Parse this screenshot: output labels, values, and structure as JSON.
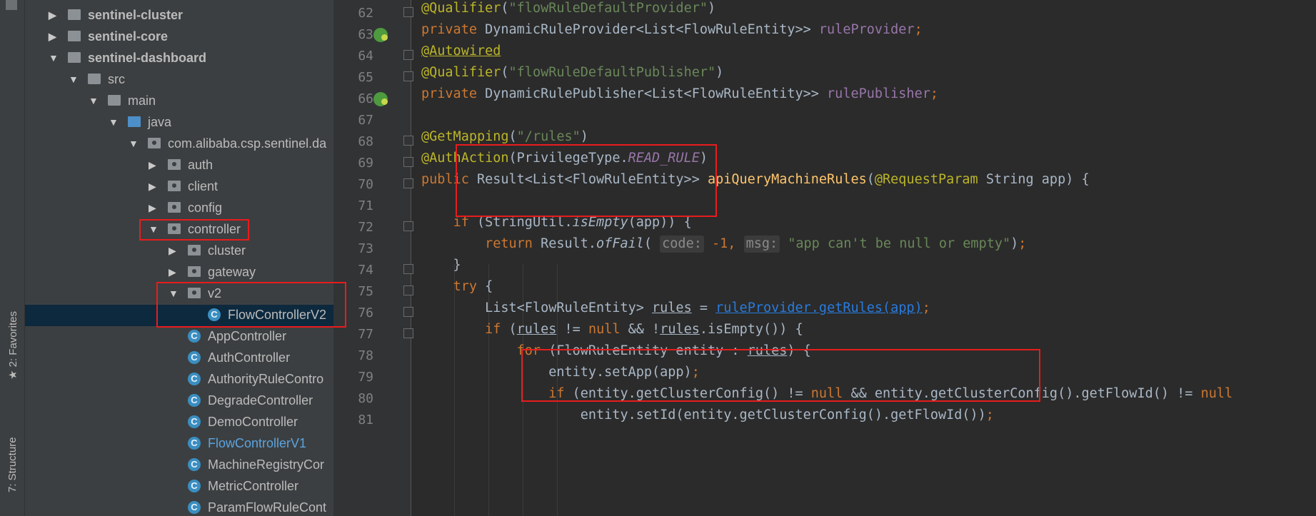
{
  "side_tabs": {
    "favorites": "2: Favorites",
    "structure": "7: Structure"
  },
  "tree": [
    {
      "label": "sentinel-cluster",
      "level": 0,
      "icon": "module",
      "arrow": "▶",
      "bold": true
    },
    {
      "label": "sentinel-core",
      "level": 0,
      "icon": "module",
      "arrow": "▶",
      "bold": true
    },
    {
      "label": "sentinel-dashboard",
      "level": 0,
      "icon": "module",
      "arrow": "▼",
      "bold": true
    },
    {
      "label": "src",
      "level": 1,
      "icon": "folder",
      "arrow": "▼"
    },
    {
      "label": "main",
      "level": 2,
      "icon": "folder",
      "arrow": "▼"
    },
    {
      "label": "java",
      "level": 3,
      "icon": "src",
      "arrow": "▼"
    },
    {
      "label": "com.alibaba.csp.sentinel.da",
      "level": 4,
      "icon": "pkg",
      "arrow": "▼"
    },
    {
      "label": "auth",
      "level": 5,
      "icon": "pkg",
      "arrow": "▶"
    },
    {
      "label": "client",
      "level": 5,
      "icon": "pkg",
      "arrow": "▶"
    },
    {
      "label": "config",
      "level": 5,
      "icon": "pkg",
      "arrow": "▶"
    },
    {
      "label": "controller",
      "level": 5,
      "icon": "pkg",
      "arrow": "▼"
    },
    {
      "label": "cluster",
      "level": 6,
      "icon": "pkg",
      "arrow": "▶"
    },
    {
      "label": "gateway",
      "level": 6,
      "icon": "pkg",
      "arrow": "▶"
    },
    {
      "label": "v2",
      "level": 6,
      "icon": "pkg",
      "arrow": "▼"
    },
    {
      "label": "FlowControllerV2",
      "level": 7,
      "icon": "cls",
      "arrow": "",
      "selected": true
    },
    {
      "label": "AppController",
      "level": 6,
      "icon": "cls",
      "arrow": ""
    },
    {
      "label": "AuthController",
      "level": 6,
      "icon": "cls",
      "arrow": ""
    },
    {
      "label": "AuthorityRuleContro",
      "level": 6,
      "icon": "cls",
      "arrow": ""
    },
    {
      "label": "DegradeController",
      "level": 6,
      "icon": "cls",
      "arrow": ""
    },
    {
      "label": "DemoController",
      "level": 6,
      "icon": "cls",
      "arrow": ""
    },
    {
      "label": "FlowControllerV1",
      "level": 6,
      "icon": "cls",
      "arrow": "",
      "color": "#5ba4e0"
    },
    {
      "label": "MachineRegistryCor",
      "level": 6,
      "icon": "cls",
      "arrow": ""
    },
    {
      "label": "MetricController",
      "level": 6,
      "icon": "cls",
      "arrow": ""
    },
    {
      "label": "ParamFlowRuleCont",
      "level": 6,
      "icon": "cls",
      "arrow": ""
    }
  ],
  "line_numbers": [
    "62",
    "63",
    "64",
    "65",
    "66",
    "67",
    "68",
    "69",
    "70",
    "71",
    "72",
    "73",
    "74",
    "75",
    "76",
    "77",
    "78",
    "79",
    "80",
    "81"
  ],
  "code_lines": [
    [
      [
        "an",
        "@Qualifier"
      ],
      [
        "",
        "("
      ],
      [
        "st",
        "\"flowRuleDefaultProvider\""
      ],
      [
        "",
        ")"
      ]
    ],
    [
      [
        "kw",
        "private "
      ],
      [
        "",
        "DynamicRuleProvider<List<FlowRuleEntity>> "
      ],
      [
        "fd",
        "ruleProvider"
      ],
      [
        "kw",
        ";"
      ]
    ],
    [
      [
        "an und",
        "@Autowired"
      ]
    ],
    [
      [
        "an",
        "@Qualifier"
      ],
      [
        "",
        "("
      ],
      [
        "st",
        "\"flowRuleDefaultPublisher\""
      ],
      [
        "",
        ")"
      ]
    ],
    [
      [
        "kw",
        "private "
      ],
      [
        "",
        "DynamicRulePublisher<List<FlowRuleEntity>> "
      ],
      [
        "fd",
        "rulePublisher"
      ],
      [
        "kw",
        ";"
      ]
    ],
    [],
    [
      [
        "an",
        "@GetMapping"
      ],
      [
        "",
        "("
      ],
      [
        "st",
        "\"/rules\""
      ],
      [
        "",
        ")"
      ]
    ],
    [
      [
        "an",
        "@AuthAction"
      ],
      [
        "",
        "(PrivilegeType."
      ],
      [
        "fd it",
        "READ_RULE"
      ],
      [
        "",
        ")"
      ]
    ],
    [
      [
        "kw",
        "public "
      ],
      [
        "",
        "Result<List<FlowRuleEntity>> "
      ],
      [
        "fn",
        "apiQueryMachineRules"
      ],
      [
        "",
        "("
      ],
      [
        "an",
        "@RequestParam "
      ],
      [
        "",
        "String app) {"
      ]
    ],
    [],
    [
      [
        "",
        "    "
      ],
      [
        "kw",
        "if "
      ],
      [
        "",
        "(StringUtil."
      ],
      [
        "it",
        "isEmpty"
      ],
      [
        "",
        "(app)) {"
      ]
    ],
    [
      [
        "",
        "        "
      ],
      [
        "kw",
        "return "
      ],
      [
        "",
        "Result."
      ],
      [
        "it",
        "ofFail"
      ],
      [
        "",
        "( "
      ],
      [
        "hint",
        "code:"
      ],
      [
        "",
        ""
      ],
      [
        "kw",
        " -1"
      ],
      [
        "kw",
        ", "
      ],
      [
        "hint",
        "msg:"
      ],
      [
        "st",
        " \"app can't be null or empty\""
      ],
      [
        "",
        ")"
      ],
      [
        "kw",
        ";"
      ]
    ],
    [
      [
        "",
        "    }"
      ]
    ],
    [
      [
        "",
        "    "
      ],
      [
        "kw",
        "try "
      ],
      [
        "",
        "{"
      ]
    ],
    [
      [
        "",
        "        List<FlowRuleEntity> "
      ],
      [
        "und",
        "rules"
      ],
      [
        "",
        " = "
      ],
      [
        "lnk",
        "ruleProvider.getRules(app)"
      ],
      [
        "kw",
        ";"
      ]
    ],
    [
      [
        "",
        "        "
      ],
      [
        "kw",
        "if "
      ],
      [
        "",
        "("
      ],
      [
        "und",
        "rules"
      ],
      [
        "",
        " != "
      ],
      [
        "kw",
        "null "
      ],
      [
        "",
        "&& !"
      ],
      [
        "und",
        "rules"
      ],
      [
        "",
        ".isEmpty()) {"
      ]
    ],
    [
      [
        "",
        "            "
      ],
      [
        "kw",
        "for "
      ],
      [
        "",
        "(FlowRuleEntity entity : "
      ],
      [
        "und",
        "rules"
      ],
      [
        "",
        ") {"
      ]
    ],
    [
      [
        "",
        "                entity.setApp(app)"
      ],
      [
        "kw",
        ";"
      ]
    ],
    [
      [
        "",
        "                "
      ],
      [
        "kw",
        "if "
      ],
      [
        "",
        "(entity.getClusterConfig() != "
      ],
      [
        "kw",
        "null "
      ],
      [
        "",
        "&& entity.getClusterConfig().getFlowId() != "
      ],
      [
        "kw",
        "null"
      ]
    ],
    [
      [
        "",
        "                    entity.setId(entity.getClusterConfig().getFlowId())"
      ],
      [
        "kw",
        ";"
      ]
    ]
  ]
}
